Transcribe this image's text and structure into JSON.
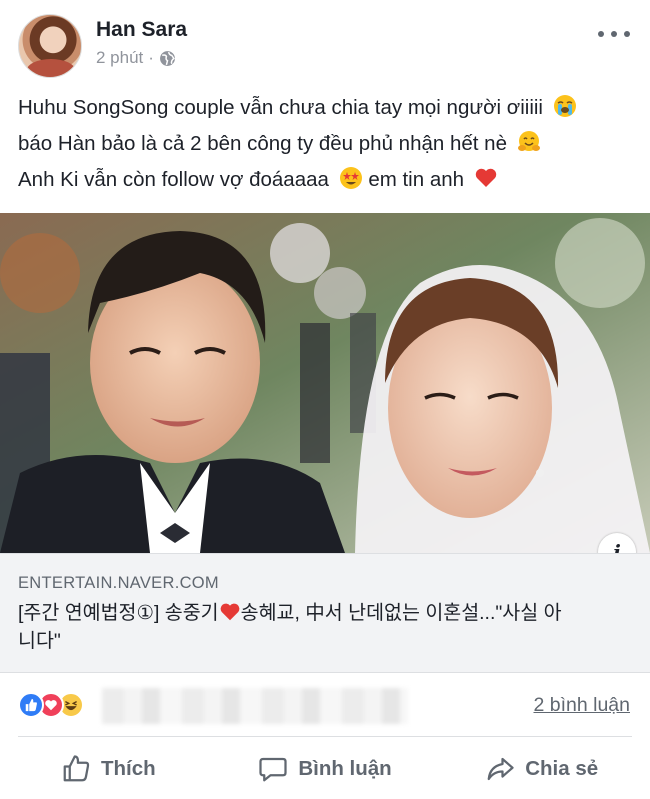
{
  "post": {
    "author": "Han Sara",
    "time": "2 phút",
    "privacy_icon": "globe-icon",
    "text_lines": [
      "Huhu SongSong couple vẫn chưa chia tay mọi người ơiiiii",
      "báo Hàn bảo là cả 2 bên công ty đều phủ nhận hết nè",
      "Anh Ki vẫn còn follow vợ đoáaaaa",
      "em tin anh"
    ],
    "emojis": [
      "loudly-crying-face",
      "hugging-face",
      "star-struck-face",
      "red-heart"
    ]
  },
  "link": {
    "domain": "ENTERTAIN.NAVER.COM",
    "title_part1": "[주간 연예법정①] 송중기",
    "title_part2": "송혜교, 中서 난데없는 이혼설...\"사실 아",
    "title_part3": "니다\"",
    "info_label": "i",
    "image": "wedding photo of couple"
  },
  "reactions": {
    "types": [
      "like",
      "love",
      "haha"
    ],
    "comment_count": "2 bình luận"
  },
  "actions": {
    "like": "Thích",
    "comment": "Bình luận",
    "share": "Chia sẻ"
  },
  "colors": {
    "like_blue": "#2f7cf6",
    "love_red": "#f0405a",
    "haha_yellow": "#f8c949",
    "meta_gray": "#606770"
  }
}
